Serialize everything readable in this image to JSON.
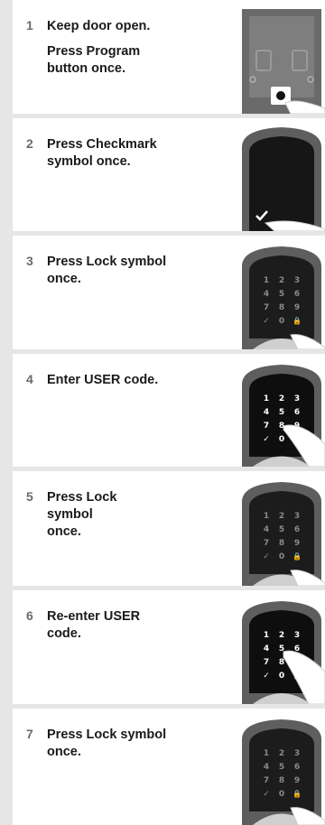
{
  "steps": [
    {
      "number": "1",
      "lines": [
        "Keep door open.",
        "Press Program button once."
      ],
      "image": "lock-program-button-icon"
    },
    {
      "number": "2",
      "lines": [
        "Press Checkmark symbol once."
      ],
      "image": "keypad-checkmark-icon"
    },
    {
      "number": "3",
      "lines": [
        "Press Lock symbol once."
      ],
      "image": "keypad-lock-icon"
    },
    {
      "number": "4",
      "lines": [
        "Enter USER code."
      ],
      "image": "keypad-enter-code-icon"
    },
    {
      "number": "5",
      "lines": [
        "Press Lock symbol once."
      ],
      "image": "keypad-lock-icon"
    },
    {
      "number": "6",
      "lines": [
        "Re-enter USER code."
      ],
      "image": "keypad-enter-code-icon"
    },
    {
      "number": "7",
      "lines": [
        "Press Lock symbol once."
      ],
      "image": "keypad-lock-icon"
    }
  ],
  "keypad": {
    "keys": [
      "1",
      "2",
      "3",
      "4",
      "5",
      "6",
      "7",
      "8",
      "9",
      "✓",
      "0",
      "🔒"
    ]
  },
  "colors": {
    "background": "#e6e6e6",
    "card": "#ffffff",
    "number": "#6b6b6b",
    "text": "#1a1a1a",
    "lock_body": "#5e5e5e",
    "keypad": "#1c1c1c"
  }
}
